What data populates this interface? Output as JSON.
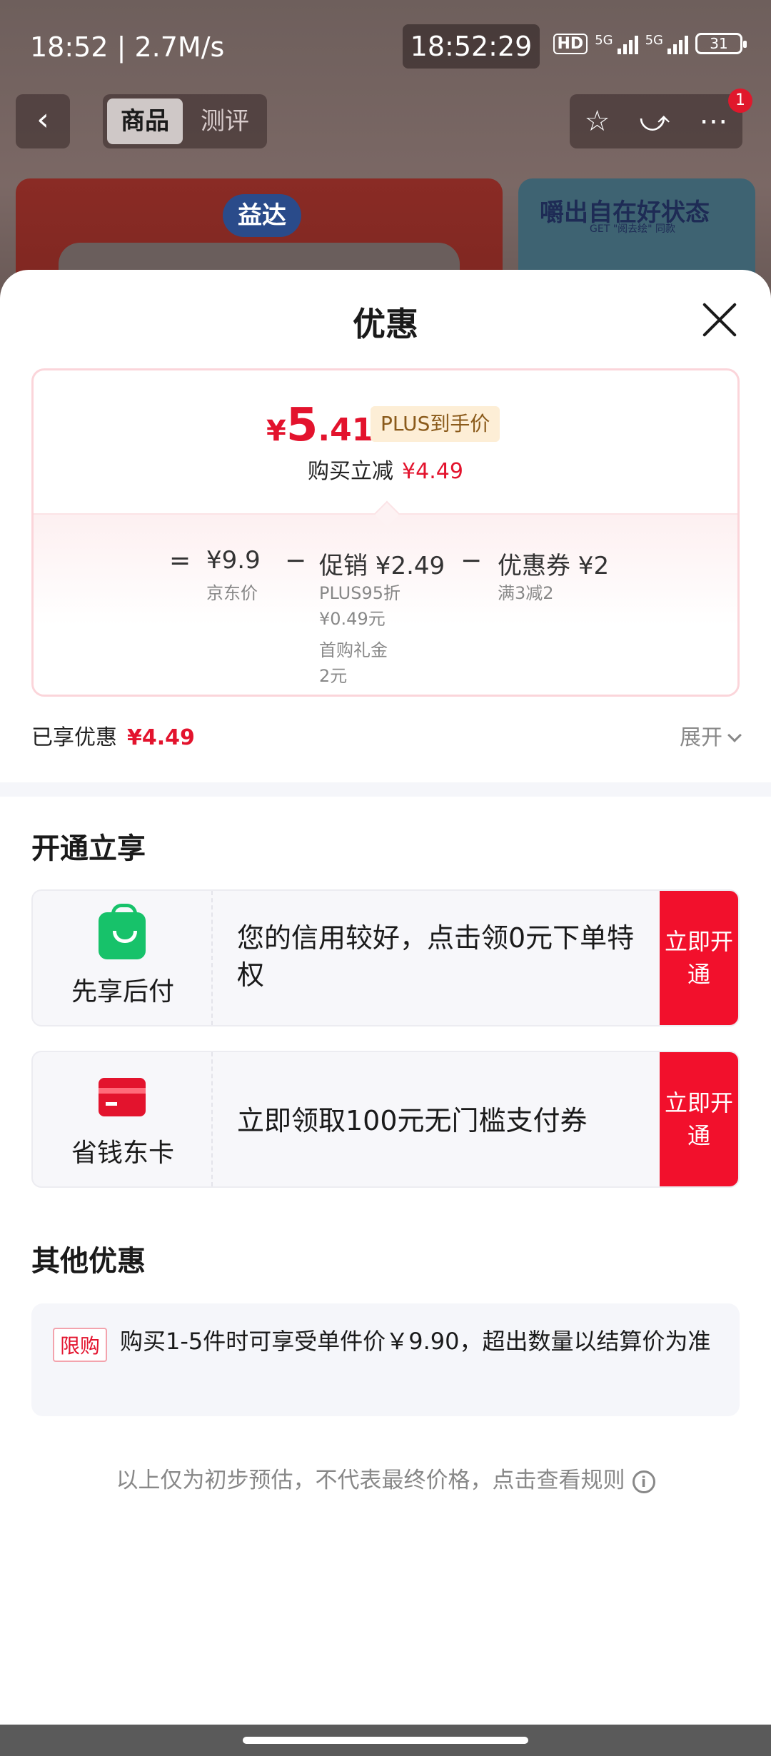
{
  "status_bar": {
    "time_speed": "18:52 | 2.7M/s",
    "clock": "18:52:29",
    "hd": "HD",
    "net1": "5G",
    "net2": "5G",
    "battery": "31"
  },
  "top_nav": {
    "tabs": [
      {
        "label": "商品"
      },
      {
        "label": "测评"
      }
    ],
    "badge": "1"
  },
  "banner": {
    "left_logo": "益达",
    "right_title": "嚼出自在好状态",
    "right_sub": "GET \"阅去绘\" 同款"
  },
  "sheet": {
    "title": "优惠",
    "final_price": {
      "symbol": "¥",
      "integer": "5",
      "decimal": ".41"
    },
    "plus_tag": "PLUS到手价",
    "saving_label": "购买立减",
    "saving_amount": "¥4.49",
    "calc": {
      "eq": "=",
      "jd_price": "¥9.9",
      "jd_price_label": "京东价",
      "minus1": "−",
      "promo": "促销 ¥2.49",
      "promo_sub1": "PLUS95折",
      "promo_sub2": "¥0.49元",
      "promo_sub3": "首购礼金",
      "promo_sub4": "2元",
      "minus2": "−",
      "coupon": "优惠券 ¥2",
      "coupon_sub": "满3减2"
    },
    "enjoyed_label": "已享优惠",
    "enjoyed_amount": "¥4.49",
    "expand_label": "展开"
  },
  "open_section": {
    "title": "开通立享",
    "offers": [
      {
        "name": "先享后付",
        "desc": "您的信用较好，点击领0元下单特权",
        "button": "立即开通"
      },
      {
        "name": "省钱东卡",
        "desc": "立即领取100元无门槛支付券",
        "button": "立即开通"
      }
    ]
  },
  "other_section": {
    "title": "其他优惠",
    "tag": "限购",
    "text": "购买1-5件时可享受单件价￥9.90，超出数量以结算价为准"
  },
  "footnote": "以上仅为初步预估，不代表最终价格，点击查看规则",
  "colors": {
    "accent_red": "#e3132d",
    "button_red": "#f2102c",
    "green_icon": "#17c26a"
  },
  "icons": [
    "back-arrow-icon",
    "star-icon",
    "share-icon",
    "more-icon",
    "close-icon",
    "shopping-bag-icon",
    "card-icon",
    "info-icon",
    "chevron-down-icon"
  ]
}
